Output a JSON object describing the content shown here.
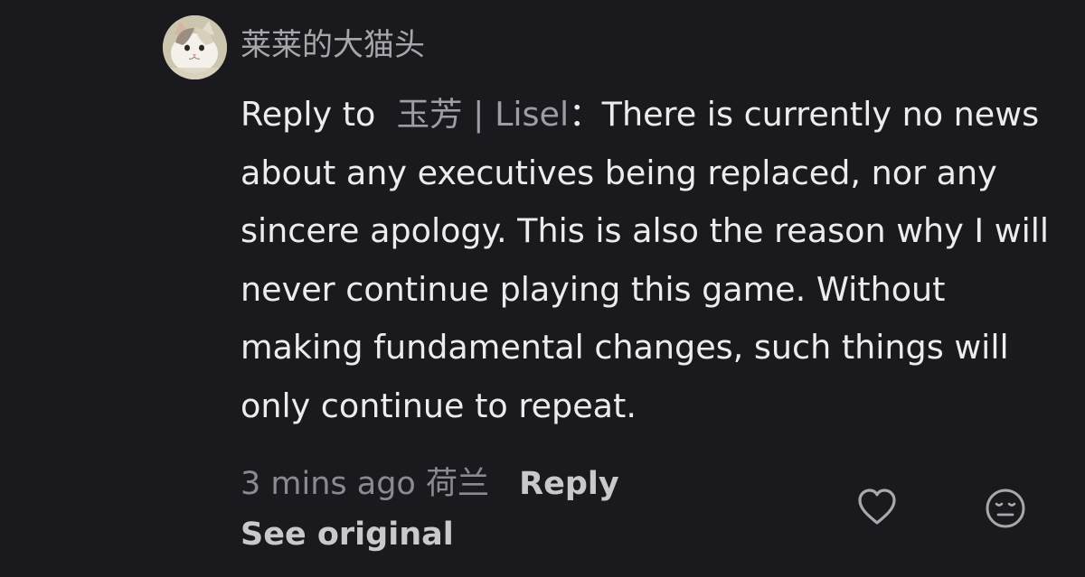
{
  "comment": {
    "author": {
      "name": "莱莱的大猫头",
      "avatar_icon": "cat-avatar"
    },
    "reply_prefix": "Reply to",
    "reply_target": "玉芳 | Lisel",
    "reply_separator": "：",
    "body": "There is currently no news about any executives being replaced, nor any sincere apology. This is also the reason why I will never continue playing this game. Without making fundamental changes, such things will only continue to repeat.",
    "time": "3 mins ago",
    "location": "荷兰",
    "reply_label": "Reply",
    "see_original_label": "See original",
    "like_icon": "heart-outline-icon",
    "dislike_icon": "neutral-face-icon"
  },
  "colors": {
    "background": "#1a191e",
    "primary_text": "#ececef",
    "secondary_text": "#9e9da3",
    "muted_text": "#8b8a90",
    "link_text": "#c9c8cc"
  }
}
